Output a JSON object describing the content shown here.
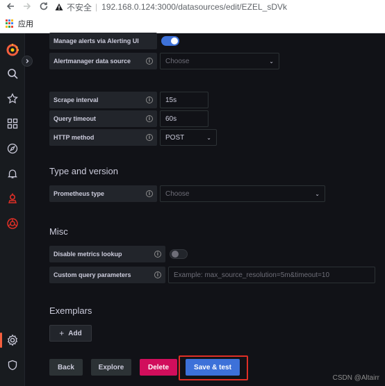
{
  "browser": {
    "insecure_label": "不安全",
    "url": "192.168.0.124:3000/datasources/edit/EZEL_sDVk",
    "apps_label": "应用"
  },
  "alerting": {
    "manage_label": "Manage alerts via Alerting UI",
    "manage_enabled": true,
    "am_source_label": "Alertmanager data source",
    "am_source_value": "Choose"
  },
  "http": {
    "scrape_label": "Scrape interval",
    "scrape_value": "15s",
    "timeout_label": "Query timeout",
    "timeout_value": "60s",
    "method_label": "HTTP method",
    "method_value": "POST"
  },
  "type_version": {
    "title": "Type and version",
    "prom_type_label": "Prometheus type",
    "prom_type_value": "Choose"
  },
  "misc": {
    "title": "Misc",
    "disable_lookup_label": "Disable metrics lookup",
    "disable_lookup_enabled": false,
    "custom_params_label": "Custom query parameters",
    "custom_params_placeholder": "Example: max_source_resolution=5m&timeout=10"
  },
  "exemplars": {
    "title": "Exemplars",
    "add_label": "Add"
  },
  "actions": {
    "back": "Back",
    "explore": "Explore",
    "delete": "Delete",
    "save_test": "Save & test"
  },
  "watermark": "CSDN @Altairr",
  "colors": {
    "brand": "#f55f3e",
    "primary": "#3d71d9",
    "danger": "#d10e5c",
    "highlight": "#e02f26"
  }
}
